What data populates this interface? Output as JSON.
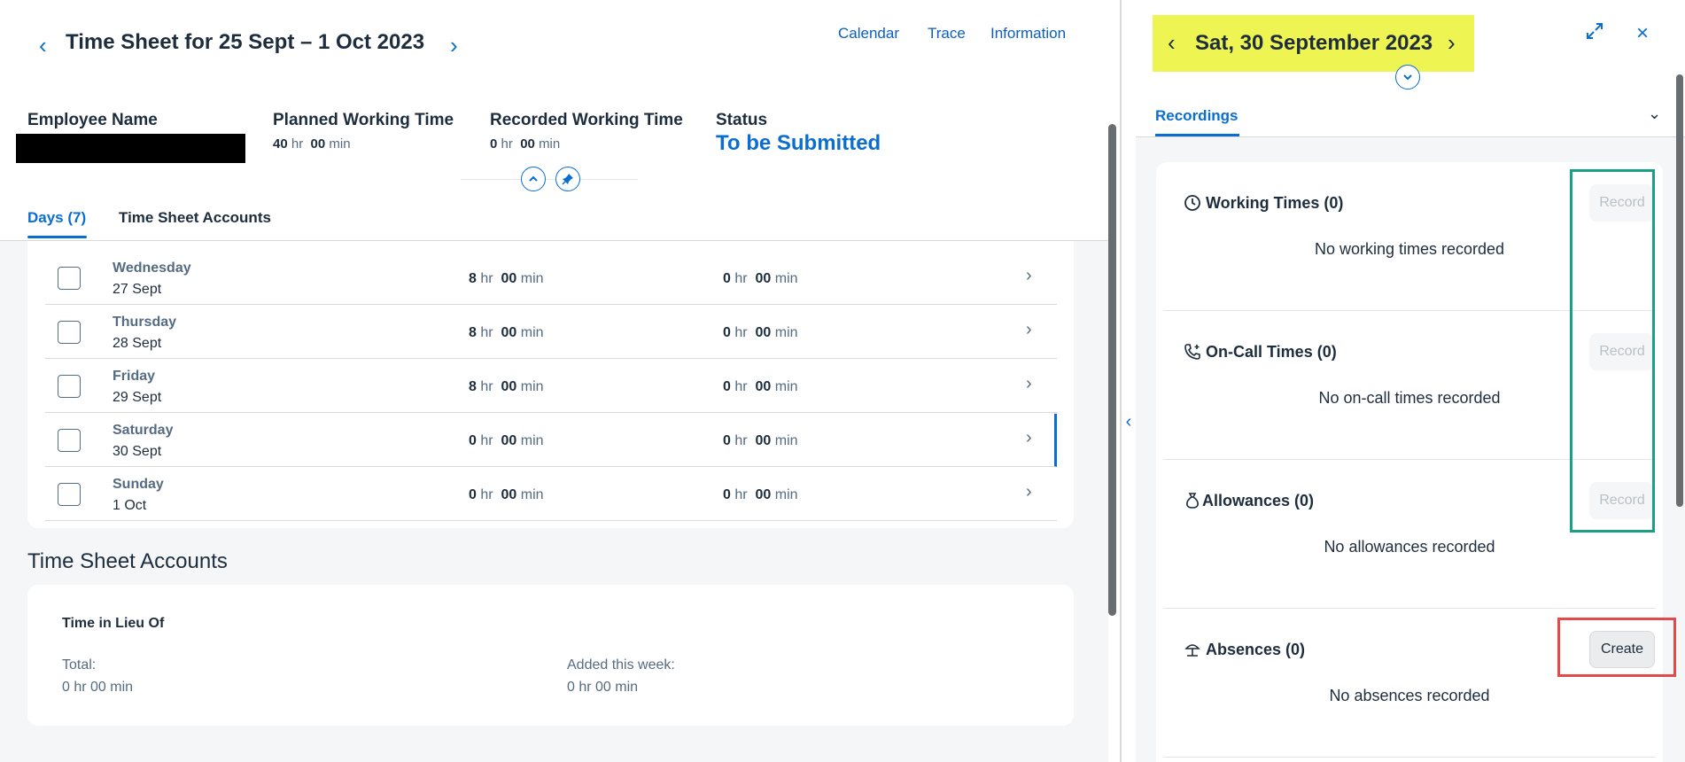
{
  "header": {
    "title": "Time Sheet for 25 Sept – 1 Oct 2023",
    "links": [
      "Calendar",
      "Trace",
      "Information"
    ]
  },
  "kpis": {
    "employee_label": "Employee Name",
    "planned_label": "Planned Working Time",
    "planned_hr": "40",
    "planned_min": "00",
    "recorded_label": "Recorded Working Time",
    "recorded_hr": "0",
    "recorded_min": "00",
    "status_label": "Status",
    "status_value": "To be Submitted",
    "hr_unit": "hr",
    "min_unit": "min"
  },
  "tabs": {
    "days": "Days (7)",
    "accounts": "Time Sheet Accounts"
  },
  "days": [
    {
      "day": "Wednesday",
      "date": "27 Sept",
      "planned_hr": "8",
      "planned_min": "00",
      "recorded_hr": "0",
      "recorded_min": "00"
    },
    {
      "day": "Thursday",
      "date": "28 Sept",
      "planned_hr": "8",
      "planned_min": "00",
      "recorded_hr": "0",
      "recorded_min": "00"
    },
    {
      "day": "Friday",
      "date": "29 Sept",
      "planned_hr": "8",
      "planned_min": "00",
      "recorded_hr": "0",
      "recorded_min": "00"
    },
    {
      "day": "Saturday",
      "date": "30 Sept",
      "planned_hr": "0",
      "planned_min": "00",
      "recorded_hr": "0",
      "recorded_min": "00"
    },
    {
      "day": "Sunday",
      "date": "1 Oct",
      "planned_hr": "0",
      "planned_min": "00",
      "recorded_hr": "0",
      "recorded_min": "00"
    }
  ],
  "accounts": {
    "title": "Time Sheet Accounts",
    "account_name": "Time in Lieu Of",
    "total_label": "Total:",
    "total_value": "0 hr 00 min",
    "added_label": "Added this week:",
    "added_value": "0 hr 00 min"
  },
  "detail": {
    "date_title": "Sat, 30 September 2023",
    "tab": "Recordings",
    "sections": [
      {
        "title": "Working Times (0)",
        "empty": "No working times recorded",
        "button": "Record",
        "icon": "clock-icon"
      },
      {
        "title": "On-Call Times (0)",
        "empty": "No on-call times recorded",
        "button": "Record",
        "icon": "phone-icon"
      },
      {
        "title": "Allowances (0)",
        "empty": "No allowances recorded",
        "button": "Record",
        "icon": "money-bag-icon"
      },
      {
        "title": "Absences (0)",
        "empty": "No absences recorded",
        "button": "Create",
        "icon": "beach-icon"
      }
    ]
  },
  "colors": {
    "accent": "#0a6ed1",
    "date_highlight": "#eef553",
    "annotation_green": "#1ca085",
    "annotation_red": "#e34b4b"
  }
}
